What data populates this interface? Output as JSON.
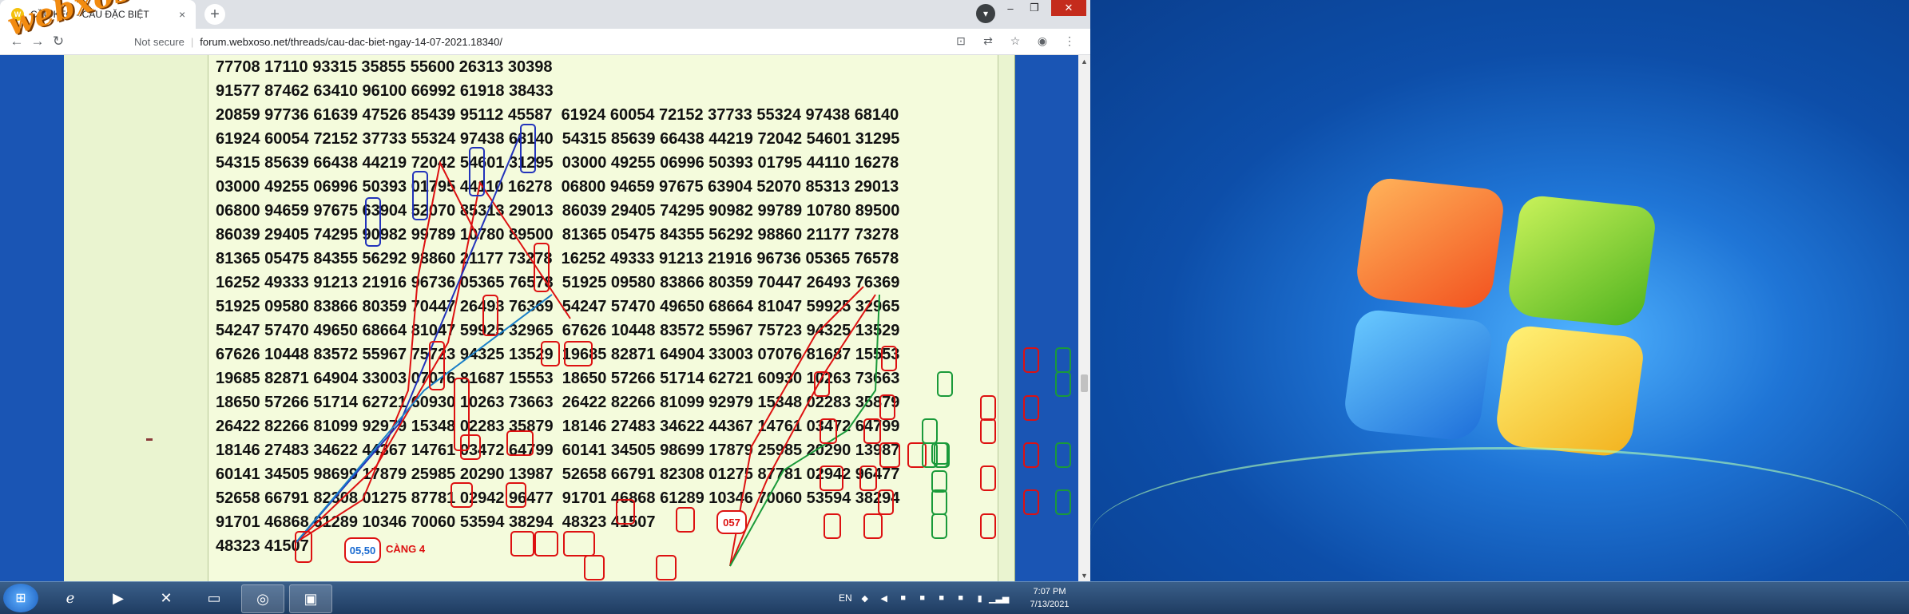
{
  "browser": {
    "tab_title": "CẦU KÈO - CẦU ĐẶC BIỆT",
    "tab_close": "×",
    "new_tab": "+",
    "not_secure": "Not secure",
    "url": "forum.webxoso.net/threads/cau-dac-biet-ngay-14-07-2021.18340/",
    "watermark": "webxoso.net"
  },
  "post": {
    "lines": [
      "77708 17110 93315 35855 55600 26313 30398",
      "91577 87462 63410 96100 66992 61918 38433",
      "20859 97736 61639 47526 85439 95112 45587  61924 60054 72152 37733 55324 97438 68140",
      "61924 60054 72152 37733 55324 97438 68140  54315 85639 66438 44219 72042 54601 31295",
      "54315 85639 66438 44219 72042 54601 31295  03000 49255 06996 50393 01795 44110 16278",
      "03000 49255 06996 50393 01795 44110 16278  06800 94659 97675 63904 52070 85313 29013",
      "06800 94659 97675 63904 52070 85313 29013  86039 29405 74295 90982 99789 10780 89500",
      "86039 29405 74295 90982 99789 10780 89500  81365 05475 84355 56292 98860 21177 73278",
      "81365 05475 84355 56292 98860 21177 73278  16252 49333 91213 21916 96736 05365 76578",
      "16252 49333 91213 21916 96736 05365 76578  51925 09580 83866 80359 70447 26493 76369",
      "51925 09580 83866 80359 70447 26493 76369  54247 57470 49650 68664 81047 59925 32965",
      "54247 57470 49650 68664 81047 59925 32965  67626 10448 83572 55967 75723 94325 13529",
      "67626 10448 83572 55967 75723 94325 13529  19685 82871 64904 33003 07076 81687 15553",
      "19685 82871 64904 33003 07076 81687 15553  18650 57266 51714 62721 60930 10263 73663",
      "18650 57266 51714 62721 60930 10263 73663  26422 82266 81099 92979 15348 02283 35879",
      "26422 82266 81099 92979 15348 02283 35879  18146 27483 34622 44367 14761 03472 64799",
      "18146 27483 34622 44367 14761 03472 64799  60141 34505 98699 17879 25985 20290 13987",
      "60141 34505 98699 17879 25985 20290 13987  52658 66791 82308 01275 87781 02942 96477",
      "52658 66791 82308 01275 87781 02942 96477  91701 46868 61289 10346 70060 53594 38294",
      "91701 46868 61289 10346 70060 53594 38294  48323 41507",
      "48323 41507"
    ],
    "badge_left": "05,50",
    "badge_right": "057",
    "cang_label": "CÀNG 4"
  },
  "taskbar": {
    "lang": "EN",
    "time": "7:07 PM",
    "date": "7/13/2021"
  },
  "colors": {
    "annotation_red": "#d11111",
    "annotation_green": "#1a9a3a",
    "annotation_blue": "#2233bb",
    "watermark": "#f28b10"
  }
}
